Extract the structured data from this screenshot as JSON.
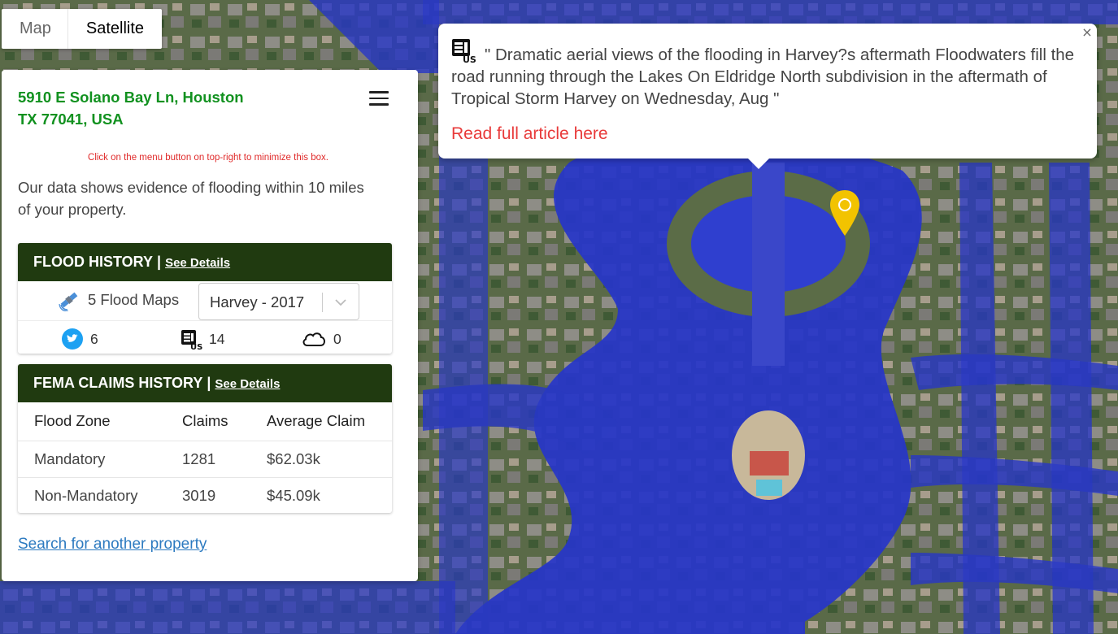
{
  "map": {
    "type_buttons": [
      "Map",
      "Satellite"
    ],
    "active_type": "Satellite",
    "flood_color": "#2736c9"
  },
  "panel": {
    "address_line1": "5910 E Solano Bay Ln, Houston",
    "address_line2": "TX 77041, USA",
    "hint": "Click on the menu button on top-right to minimize this box.",
    "evidence": "Our data shows evidence of flooding within 10 miles of your property.",
    "flood_history": {
      "title": "FLOOD HISTORY",
      "separator": "|",
      "link": "See Details",
      "maps_label": "5 Flood Maps",
      "selected_map": "Harvey - 2017",
      "stats": [
        {
          "icon": "twitter-icon",
          "value": "6"
        },
        {
          "icon": "news-us-icon",
          "value": "14"
        },
        {
          "icon": "cloud-icon",
          "value": "0"
        }
      ]
    },
    "fema": {
      "title": "FEMA CLAIMS HISTORY",
      "separator": "|",
      "link": "See Details",
      "headers": [
        "Flood Zone",
        "Claims",
        "Average Claim"
      ],
      "rows": [
        [
          "Mandatory",
          "1281",
          "$62.03k"
        ],
        [
          "Non-Mandatory",
          "3019",
          "$45.09k"
        ]
      ]
    },
    "search_link": "Search for another property"
  },
  "popup": {
    "text": "\" Dramatic aerial views of the flooding in Harvey?s aftermath Floodwaters fill the road running through the Lakes On Eldridge North subdivision in the aftermath of Tropical Storm Harvey on Wednesday, Aug \"",
    "link": "Read full article here",
    "close": "×"
  },
  "colors": {
    "address": "#11911f",
    "card_header": "#203a10",
    "hint": "#e02a2a",
    "link": "#2c7ac0",
    "article_link": "#e83a3a",
    "pin": "#f2c300"
  }
}
